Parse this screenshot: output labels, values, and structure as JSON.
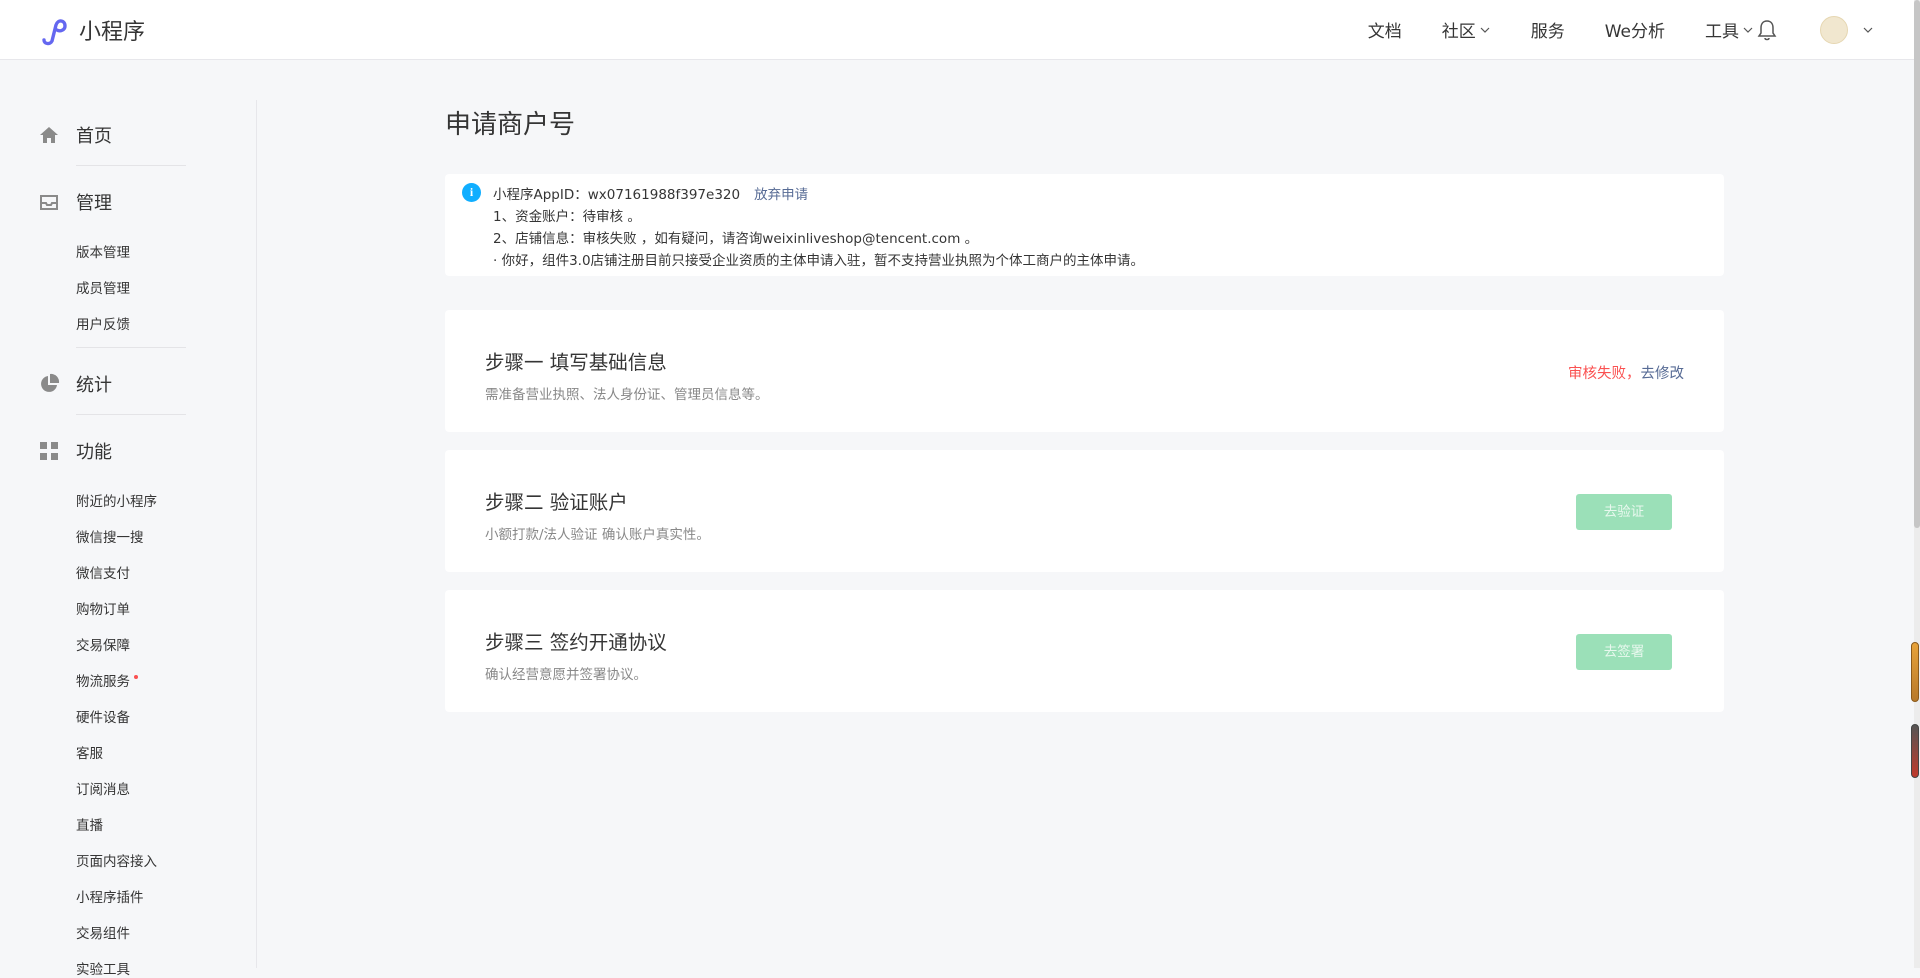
{
  "header": {
    "logo_text": "小程序",
    "nav": [
      {
        "label": "文档",
        "has_caret": false
      },
      {
        "label": "社区",
        "has_caret": true
      },
      {
        "label": "服务",
        "has_caret": false
      },
      {
        "label": "We分析",
        "has_caret": false
      },
      {
        "label": "工具",
        "has_caret": true
      }
    ],
    "icons": [
      "bell-icon",
      "avatar",
      "chevron-down-icon"
    ]
  },
  "sidebar": {
    "sections": [
      {
        "label": "首页",
        "icon": "home-icon",
        "items": []
      },
      {
        "label": "管理",
        "icon": "inbox-icon",
        "items": [
          "版本管理",
          "成员管理",
          "用户反馈"
        ]
      },
      {
        "label": "统计",
        "icon": "pie-chart-icon",
        "items": []
      },
      {
        "label": "功能",
        "icon": "grid-icon",
        "items": [
          "附近的小程序",
          "微信搜一搜",
          "微信支付",
          "购物订单",
          "交易保障",
          "物流服务",
          "硬件设备",
          "客服",
          "订阅消息",
          "直播",
          "页面内容接入",
          "小程序插件",
          "交易组件",
          "实验工具"
        ]
      }
    ],
    "badge_item": "物流服务"
  },
  "main": {
    "title": "申请商户号",
    "notice": {
      "appid_line": "小程序AppID：wx07161988f397e320",
      "abandon_link": "放弃申请",
      "line1": "1、资金账户：待审核 。",
      "line2": "2、店铺信息：审核失败 ，如有疑问，请咨询weixinliveshop@tencent.com 。",
      "line3": "· 你好，组件3.0店铺注册目前只接受企业资质的主体申请入驻，暂不支持营业执照为个体工商户的主体申请。"
    },
    "steps": [
      {
        "title": "步骤一 填写基础信息",
        "desc": "需准备营业执照、法人身份证、管理员信息等。",
        "status_fail": "审核失败，",
        "status_link": "去修改"
      },
      {
        "title": "步骤二 验证账户",
        "desc": "小额打款/法人验证 确认账户真实性。",
        "button": "去验证"
      },
      {
        "title": "步骤三 签约开通协议",
        "desc": "确认经营意愿并签署协议。",
        "button": "去签署"
      }
    ]
  },
  "colors": {
    "accent_link": "#576b95",
    "fail_red": "#fa5151",
    "disabled_green": "#9be0b8",
    "info_blue": "#10aeff",
    "logo_purple": "#6467f0"
  }
}
